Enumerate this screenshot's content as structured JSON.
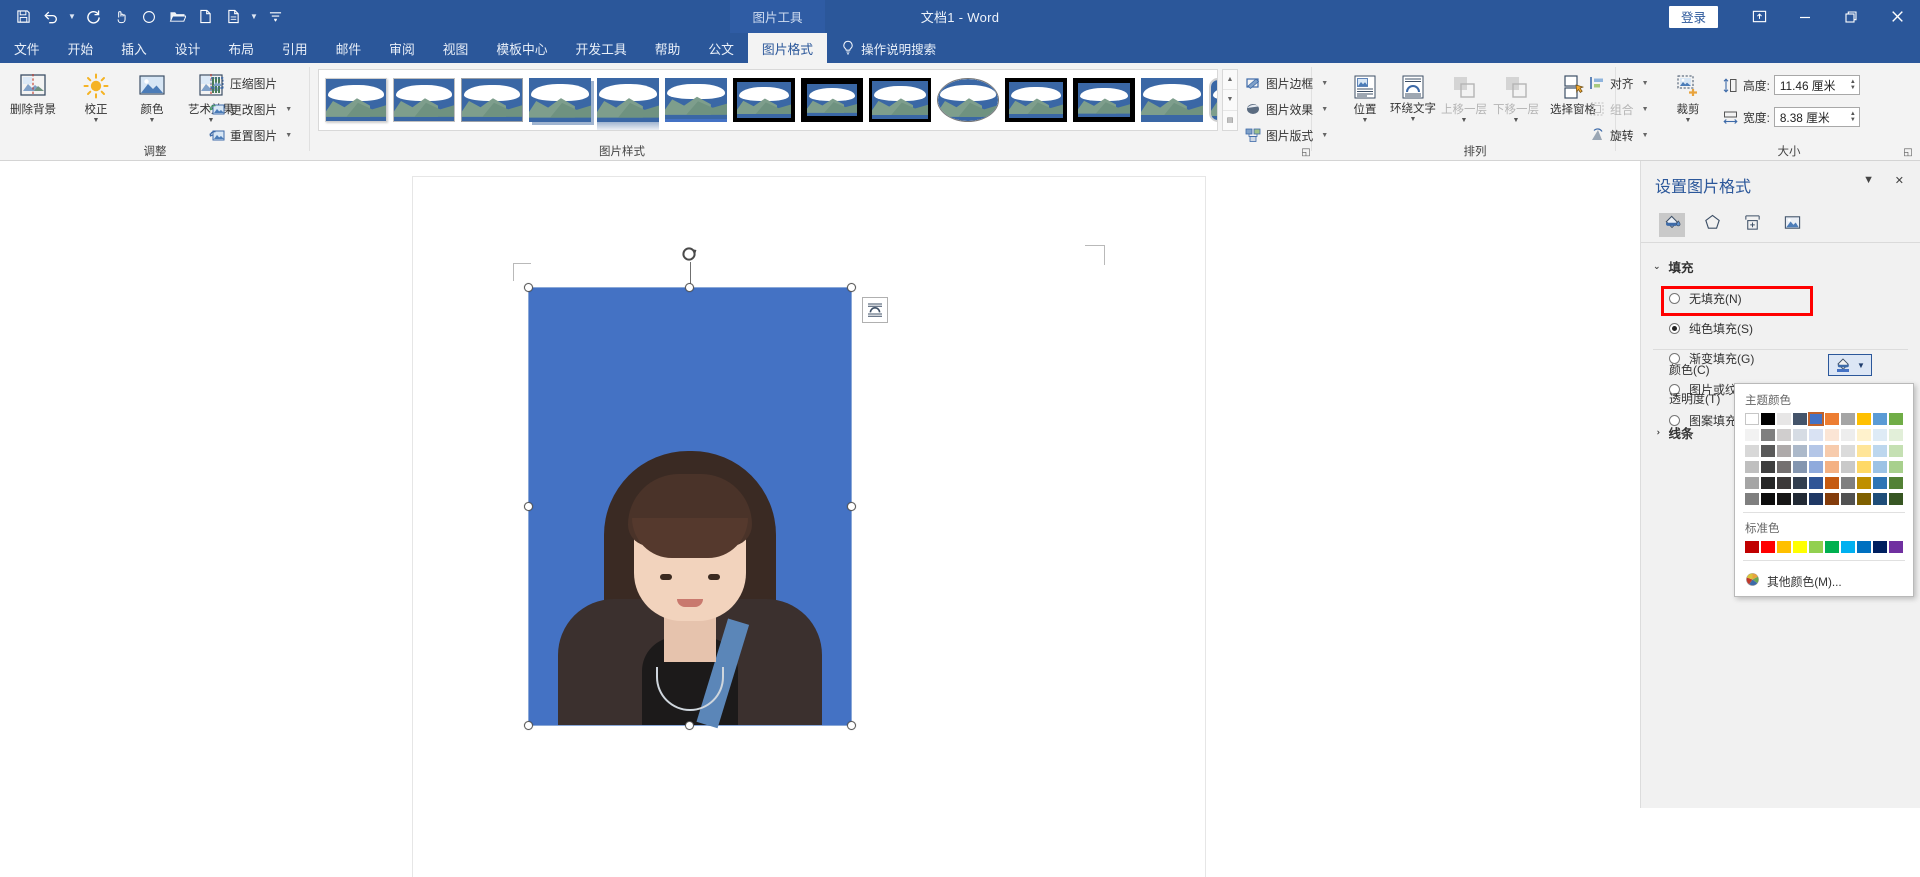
{
  "titlebar": {
    "document_title": "文档1  -  Word",
    "context_tab_label": "图片工具",
    "sign_in": "登录",
    "quick_access": [
      {
        "name": "save-icon",
        "label": "保存"
      },
      {
        "name": "undo-icon",
        "label": "撤消"
      },
      {
        "name": "redo-icon",
        "label": "恢复"
      },
      {
        "name": "touch-mode-icon",
        "label": "触摸/鼠标模式"
      },
      {
        "name": "circle-icon",
        "label": "形状"
      },
      {
        "name": "open-folder-icon",
        "label": "打开"
      },
      {
        "name": "new-doc-icon",
        "label": "新建"
      },
      {
        "name": "new-from-template-icon",
        "label": "从模板新建"
      },
      {
        "name": "customize-qat-icon",
        "label": "自定义快速访问工具栏"
      }
    ],
    "window_buttons": [
      {
        "name": "ribbon-display-options-icon",
        "glyph": "⊞"
      },
      {
        "name": "minimize-icon",
        "glyph": "—"
      },
      {
        "name": "restore-icon",
        "glyph": "❐"
      },
      {
        "name": "close-icon",
        "glyph": "✕"
      }
    ]
  },
  "tabs": [
    {
      "label": "文件",
      "active": false
    },
    {
      "label": "开始",
      "active": false
    },
    {
      "label": "插入",
      "active": false
    },
    {
      "label": "设计",
      "active": false
    },
    {
      "label": "布局",
      "active": false
    },
    {
      "label": "引用",
      "active": false
    },
    {
      "label": "邮件",
      "active": false
    },
    {
      "label": "审阅",
      "active": false
    },
    {
      "label": "视图",
      "active": false
    },
    {
      "label": "模板中心",
      "active": false
    },
    {
      "label": "开发工具",
      "active": false
    },
    {
      "label": "帮助",
      "active": false
    },
    {
      "label": "公文",
      "active": false
    },
    {
      "label": "图片格式",
      "active": true
    }
  ],
  "tell_me": "操作说明搜索",
  "ribbon": {
    "groups": [
      {
        "name": "adjust",
        "label": "调整"
      },
      {
        "name": "picture-styles",
        "label": "图片样式"
      },
      {
        "name": "arrange",
        "label": "排列"
      },
      {
        "name": "size",
        "label": "大小"
      }
    ],
    "adjust": {
      "remove_background": "删除背景",
      "corrections": "校正",
      "color": "颜色",
      "artistic_effects": "艺术效果",
      "compress_pictures": "压缩图片",
      "change_picture": "更改图片",
      "reset_picture": "重置图片"
    },
    "picture_styles": {
      "border": "图片边框",
      "effects": "图片效果",
      "layout": "图片版式",
      "gallery_count": 16,
      "selected_index": 2
    },
    "arrange": {
      "position": "位置",
      "wrap_text": "环绕文字",
      "bring_forward": "上移一层",
      "send_backward": "下移一层",
      "selection_pane": "选择窗格",
      "align": "对齐",
      "group": "组合",
      "rotate": "旋转"
    },
    "size": {
      "crop": "裁剪",
      "height_label": "高度:",
      "height_value": "11.46 厘米",
      "width_label": "宽度:",
      "width_value": "8.38 厘米"
    }
  },
  "canvas": {
    "selected_image": {
      "name": "id-photo",
      "background_color": "#4472C4",
      "handles": 8,
      "rotate_handle": true,
      "layout_options_button": "布局选项"
    }
  },
  "pane": {
    "title": "设置图片格式",
    "close_glyph": "✕",
    "dropdown_glyph": "▼",
    "tabs": [
      {
        "name": "fill-line-tab",
        "icon": "paint-bucket-icon",
        "active": true
      },
      {
        "name": "effects-tab",
        "icon": "pentagon-icon",
        "active": false
      },
      {
        "name": "layout-properties-tab",
        "icon": "size-layout-icon",
        "active": false
      },
      {
        "name": "picture-tab",
        "icon": "picture-icon",
        "active": false
      }
    ],
    "fill": {
      "section_label": "填充",
      "options": [
        {
          "label": "无填充(N)",
          "selected": false
        },
        {
          "label": "纯色填充(S)",
          "selected": true
        },
        {
          "label": "渐变填充(G)",
          "selected": false
        },
        {
          "label": "图片或纹理填充(P)",
          "selected": false
        },
        {
          "label": "图案填充(A)",
          "selected": false
        }
      ],
      "color_label": "颜色(C)",
      "transparency_label": "透明度(T)"
    },
    "line": {
      "section_label": "线条"
    },
    "highlight_box": {
      "color": "#FF0000",
      "target": "纯色填充(S)"
    }
  },
  "color_dropdown": {
    "theme_label": "主题颜色",
    "standard_label": "标准色",
    "more_colors": "其他颜色(M)...",
    "theme_colors": [
      "#FFFFFF",
      "#000000",
      "#E7E6E6",
      "#44546A",
      "#4472C4",
      "#ED7D31",
      "#A5A5A5",
      "#FFC000",
      "#5B9BD5",
      "#70AD47"
    ],
    "selected_theme_index": 4,
    "theme_variants": [
      [
        "#F2F2F2",
        "#7F7F7F",
        "#D0CECE",
        "#D6DCE4",
        "#D9E2F3",
        "#FBE5D5",
        "#EDEDED",
        "#FFF2CC",
        "#DEEBF6",
        "#E2EFD9"
      ],
      [
        "#D8D8D8",
        "#595959",
        "#AEAAAA",
        "#ACB9CA",
        "#B4C6E7",
        "#F7CBAC",
        "#DBDBDB",
        "#FFE599",
        "#BDD7EE",
        "#C5E0B3"
      ],
      [
        "#BFBFBF",
        "#3F3F3F",
        "#747070",
        "#8496B0",
        "#8FAADC",
        "#F4B183",
        "#C9C9C9",
        "#FFD966",
        "#9CC3E5",
        "#A8D08D"
      ],
      [
        "#A5A5A5",
        "#262626",
        "#3B3838",
        "#333F4F",
        "#2F5496",
        "#C55A11",
        "#808080",
        "#BF8F00",
        "#2E75B5",
        "#538135"
      ],
      [
        "#7F7F7F",
        "#0C0C0C",
        "#171616",
        "#222A35",
        "#1F3864",
        "#833C0B",
        "#525252",
        "#7F6000",
        "#1F4E79",
        "#375623"
      ]
    ],
    "standard_colors": [
      "#C00000",
      "#FF0000",
      "#FFC000",
      "#FFFF00",
      "#92D050",
      "#00B050",
      "#00B0F0",
      "#0070C0",
      "#002060",
      "#7030A0"
    ]
  },
  "colors": {
    "ribbon_blue": "#2b579a",
    "ribbon_bg": "#f3f3f3",
    "accent_blue": "#4472C4",
    "highlight_red": "#FF0000"
  }
}
